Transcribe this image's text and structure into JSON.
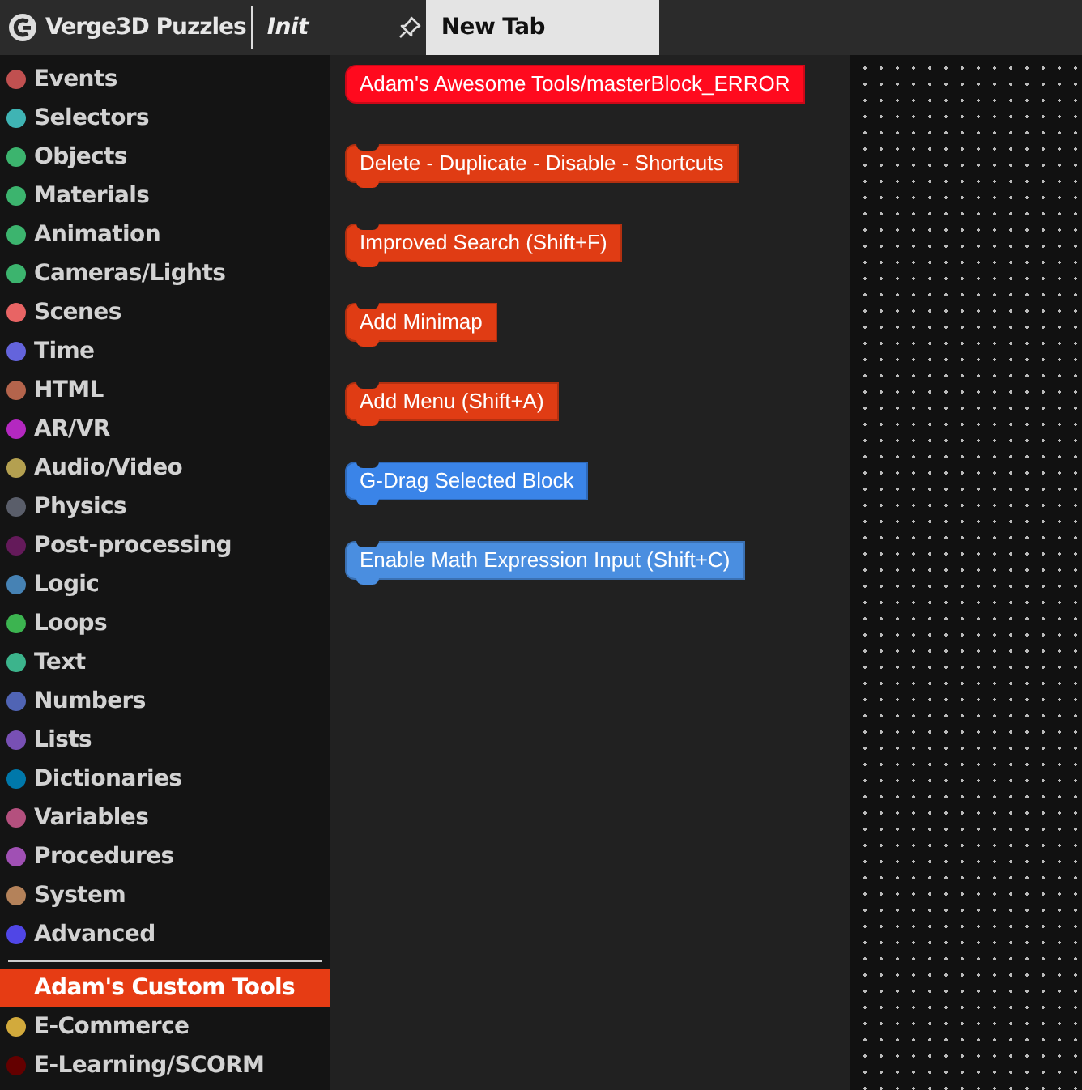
{
  "app": {
    "title": "Verge3D Puzzles"
  },
  "tabs": [
    {
      "label": "Init",
      "selected": false,
      "italic": true
    },
    {
      "label": "New Tab",
      "selected": true,
      "italic": false
    }
  ],
  "categories": [
    {
      "label": "Events",
      "color": "#c05050",
      "selected": false
    },
    {
      "label": "Selectors",
      "color": "#3fb4b4",
      "selected": false
    },
    {
      "label": "Objects",
      "color": "#3cb46e",
      "selected": false
    },
    {
      "label": "Materials",
      "color": "#3cb46e",
      "selected": false
    },
    {
      "label": "Animation",
      "color": "#3cb46e",
      "selected": false
    },
    {
      "label": "Cameras/Lights",
      "color": "#3cb46e",
      "selected": false
    },
    {
      "label": "Scenes",
      "color": "#e86464",
      "selected": false
    },
    {
      "label": "Time",
      "color": "#6464dc",
      "selected": false
    },
    {
      "label": "HTML",
      "color": "#b4644c",
      "selected": false
    },
    {
      "label": "AR/VR",
      "color": "#b428c0",
      "selected": false
    },
    {
      "label": "Audio/Video",
      "color": "#b4a050",
      "selected": false
    },
    {
      "label": "Physics",
      "color": "#5a5e6a",
      "selected": false
    },
    {
      "label": "Post-processing",
      "color": "#641a5a",
      "selected": false
    },
    {
      "label": "Logic",
      "color": "#4682b4",
      "selected": false
    },
    {
      "label": "Loops",
      "color": "#3cb450",
      "selected": false
    },
    {
      "label": "Text",
      "color": "#3cb48c",
      "selected": false
    },
    {
      "label": "Numbers",
      "color": "#5064b4",
      "selected": false
    },
    {
      "label": "Lists",
      "color": "#7850b4",
      "selected": false
    },
    {
      "label": "Dictionaries",
      "color": "#0078aa",
      "selected": false
    },
    {
      "label": "Variables",
      "color": "#b4507e",
      "selected": false
    },
    {
      "label": "Procedures",
      "color": "#a050b4",
      "selected": false
    },
    {
      "label": "System",
      "color": "#b4825a",
      "selected": false
    },
    {
      "label": "Advanced",
      "color": "#5046e6",
      "selected": false
    },
    {
      "kind": "separator"
    },
    {
      "label": "Adam's Custom Tools",
      "selected": true
    },
    {
      "label": "E-Commerce",
      "color": "#d2aa3c",
      "selected": false
    },
    {
      "label": "E-Learning/SCORM",
      "color": "#640000",
      "selected": false
    }
  ],
  "blocks": [
    {
      "label": "Adam's Awesome Tools/masterBlock_ERROR",
      "kind": "plain",
      "color": "#ff0a1e"
    },
    {
      "label": "Delete - Duplicate - Disable - Shortcuts",
      "kind": "statement",
      "color": "#e03c14"
    },
    {
      "label": "Improved Search (Shift+F)",
      "kind": "statement",
      "color": "#e03c14"
    },
    {
      "label": "Add Minimap",
      "kind": "statement",
      "color": "#e03c14"
    },
    {
      "label": "Add Menu (Shift+A)",
      "kind": "statement",
      "color": "#e03c14"
    },
    {
      "label": "G-Drag Selected Block",
      "kind": "statement",
      "color": "#3a84e8"
    },
    {
      "label": "Enable Math Expression Input (Shift+C)",
      "kind": "statement",
      "color": "#4a8ee0"
    }
  ]
}
